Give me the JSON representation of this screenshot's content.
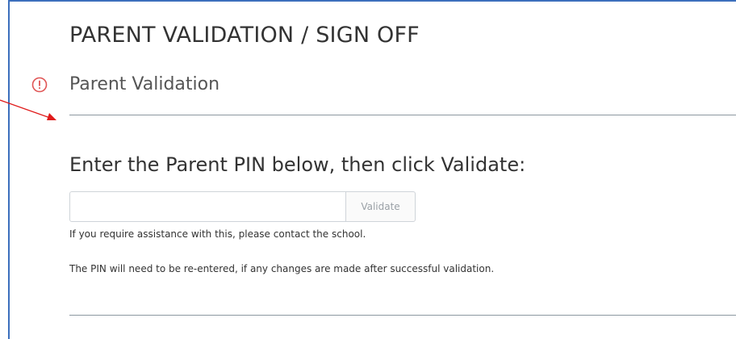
{
  "page": {
    "title": "PARENT VALIDATION / SIGN OFF",
    "section_title": "Parent Validation"
  },
  "validation": {
    "prompt": "Enter the Parent PIN below, then click Validate:",
    "pin_value": "",
    "pin_placeholder": "",
    "validate_label": "Validate",
    "help_text": "If you require assistance with this, please contact the school.",
    "note_text": "The PIN will need to be re-entered, if any changes are made after successful validation."
  },
  "icons": {
    "alert": "alert-circle-icon",
    "annotation": "red-arrow-annotation"
  },
  "colors": {
    "frame_border": "#3c6fbd",
    "alert": "#e05555",
    "arrow": "#e01b1b",
    "divider": "#8c97a0"
  }
}
